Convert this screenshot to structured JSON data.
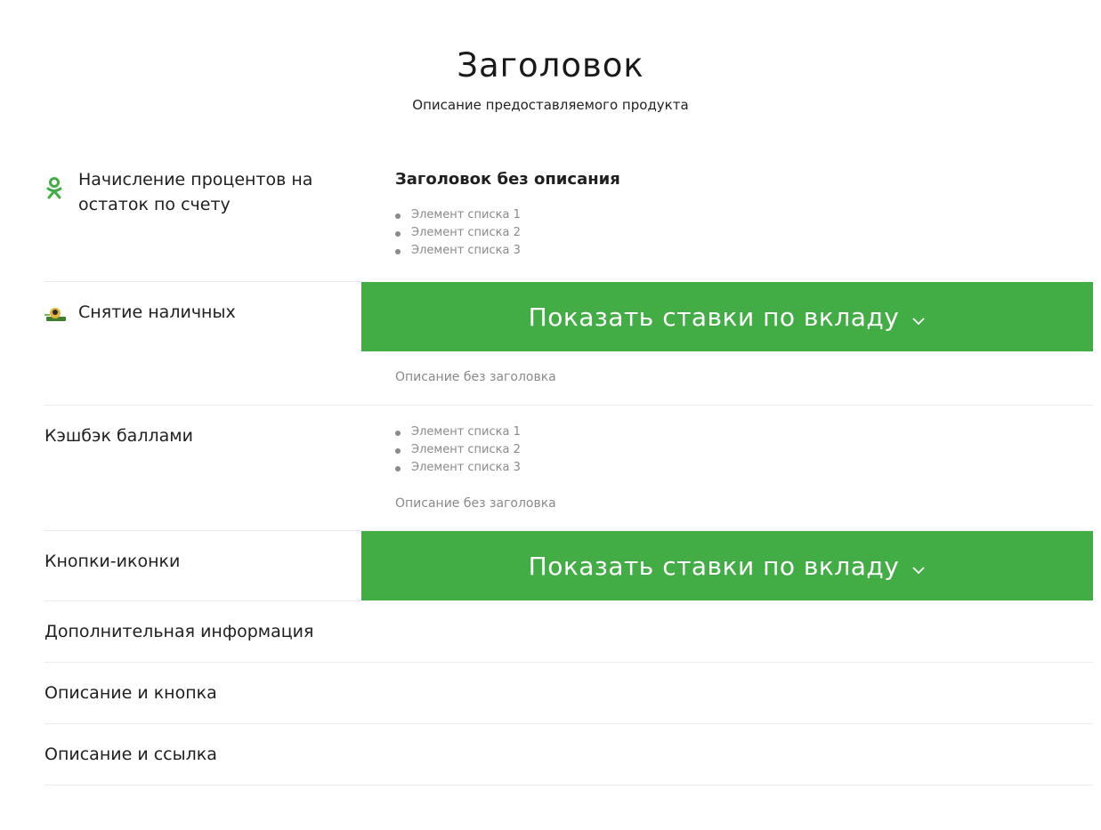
{
  "header": {
    "title": "Заголовок",
    "subtitle": "Описание предоставляемого продукта"
  },
  "rows": [
    {
      "label": "Начисление процентов на остаток по счету",
      "icon": "odnoklassniki-icon",
      "right_title": "Заголовок без описания",
      "list": [
        "Элемент списка 1",
        "Элемент списка 2",
        "Элемент списка 3"
      ]
    },
    {
      "label": "Снятие наличных",
      "icon": "cash-withdrawal-icon",
      "button_label": "Показать ставки по вкладу",
      "description": "Описание без заголовка"
    },
    {
      "label": "Кэшбэк баллами",
      "list": [
        "Элемент списка 1",
        "Элемент списка 2",
        "Элемент списка 3"
      ],
      "description": "Описание без заголовка"
    },
    {
      "label": "Кнопки-иконки",
      "button_label": "Показать ставки по вкладу"
    },
    {
      "label": "Дополнительная информация"
    },
    {
      "label": "Описание и кнопка"
    },
    {
      "label": "Описание и ссылка"
    }
  ],
  "colors": {
    "accent": "#43ad45",
    "muted_text": "#8a8a8a",
    "divider": "#ececec"
  }
}
